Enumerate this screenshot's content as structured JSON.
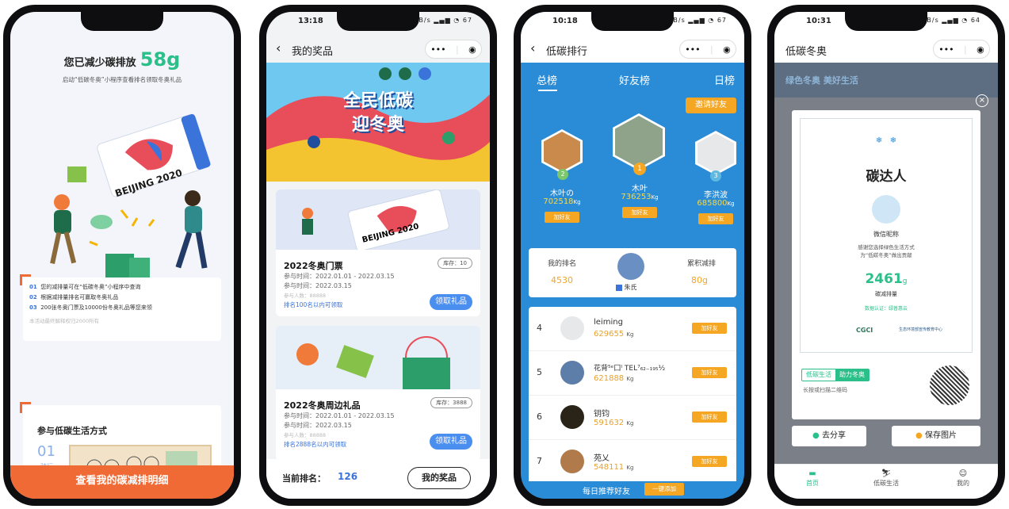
{
  "phone1": {
    "headline_prefix": "您已减少碳排放",
    "headline_value": "58g",
    "subtitle": "启动“低碳冬奥”小程序查看排名领取冬奥礼品",
    "ticket_text": "BEIJING 2020",
    "steps": [
      {
        "num": "01",
        "text": "您的减排量可在“低碳冬奥”小程序中查询"
      },
      {
        "num": "02",
        "text": "根据减排量排名可赢取冬奥礼品"
      },
      {
        "num": "03",
        "text": "200张冬奥门票及10000份冬奥礼品等您来领"
      }
    ],
    "note": "本活动最终解释权归2000所有",
    "section_title": "参与低碳生活方式",
    "section_num": "01",
    "section_sub": "骑行",
    "cta": "查看我的碳减排明细"
  },
  "phone2": {
    "time": "13:18",
    "net": "0.48 KB/s",
    "battery": "67",
    "title": "我的奖品",
    "banner_line1": "全民低碳",
    "banner_line2": "迎冬奥",
    "prizes": [
      {
        "name": "2022冬奥门票",
        "stock": "库存：10",
        "time": "参与时间：2022.01.01 - 2022.03.15",
        "time2": "参与时间：2022.03.15",
        "people": "参与人数：88888",
        "rule": "排名100名以内可领取",
        "button": "领取礼品",
        "ticket_text": "BEIJING 2020"
      },
      {
        "name": "2022冬奥周边礼品",
        "stock": "库存：3888",
        "time": "参与时间：2022.01.01 - 2022.03.15",
        "time2": "参与时间：2022.03.15",
        "people": "参与人数：88888",
        "rule": "排名2888名以内可领取",
        "button": "领取礼品"
      }
    ],
    "rank_label": "当前排名：",
    "rank_value": "126",
    "my_prize_button": "我的奖品"
  },
  "phone3": {
    "time": "10:18",
    "net": "0.09 KB/s",
    "battery": "67",
    "title": "低碳排行",
    "tabs": [
      "总榜",
      "好友榜",
      "日榜"
    ],
    "invite_button": "邀请好友",
    "podium": [
      {
        "rank": "2",
        "name": "木叶の",
        "value": "702518",
        "unit": "Kg",
        "button": "加好友"
      },
      {
        "rank": "1",
        "name": "木叶",
        "value": "736253",
        "unit": "Kg",
        "button": "加好友"
      },
      {
        "rank": "3",
        "name": "李洪波",
        "value": "685800",
        "unit": "Kg",
        "button": "加好友"
      }
    ],
    "my_rank_label": "我的排名",
    "my_rank_value": "4530",
    "my_name": "朱氏",
    "total_label": "累积减排",
    "total_value": "80g",
    "list": [
      {
        "rank": "4",
        "name": "leiming",
        "value": "629655",
        "unit": "Kg",
        "button": "加好友"
      },
      {
        "rank": "5",
        "name": "花背⁵ᵉ囗ᴵ TEL⁷₆₂₋₁₉₅½",
        "value": "621888",
        "unit": "Kg",
        "button": "加好友"
      },
      {
        "rank": "6",
        "name": "钥钧",
        "value": "591632",
        "unit": "Kg",
        "button": "加好友"
      },
      {
        "rank": "7",
        "name": "苑乂",
        "value": "548111",
        "unit": "Kg",
        "button": "加好友"
      }
    ],
    "daily_label": "每日推荐好友",
    "add_all_button": "一键添加"
  },
  "phone4": {
    "time": "10:31",
    "net": "0.00 KB/s",
    "battery": "64",
    "title": "低碳冬奥",
    "bg_banner": "绿色冬奥 美好生活",
    "card_title": "碳达人",
    "nickname": "微信昵称",
    "thanks1": "感谢您选择绿色生活方式",
    "thanks2": "为“低碳冬奥”做出贡献",
    "value": "2461",
    "unit": "g",
    "value_label": "碳减排量",
    "cert": "数据认证：绿普惠云",
    "logo1": "CGCI",
    "logo2": "生态环境部宣传教育中心",
    "tag1": "低碳生活",
    "tag2": "助力冬奥",
    "qr_hint": "长按或扫描二维码",
    "share_button": "去分享",
    "save_button": "保存图片",
    "tabbar": [
      "首页",
      "低碳生活",
      "我的"
    ]
  }
}
